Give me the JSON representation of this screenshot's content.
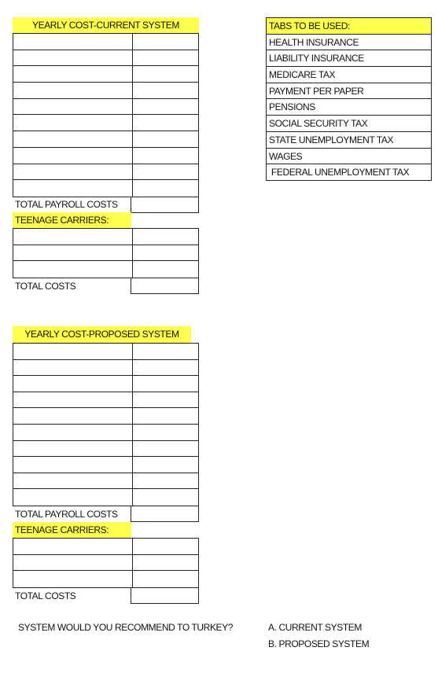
{
  "current": {
    "title": "YEARLY COST-CURRENT SYSTEM",
    "rows": 10,
    "total_payroll_label": "TOTAL PAYROLL COSTS",
    "teenage_label": "TEENAGE CARRIERS:",
    "teen_rows": 3,
    "total_costs_label": "TOTAL COSTS"
  },
  "proposed": {
    "title": "YEARLY COST-PROPOSED SYSTEM",
    "rows": 10,
    "total_payroll_label": "TOTAL PAYROLL COSTS",
    "teenage_label": "TEENAGE CARRIERS:",
    "teen_rows": 3,
    "total_costs_label": "TOTAL COSTS"
  },
  "tabs": {
    "title": "TABS TO BE USED:",
    "items": [
      "HEALTH INSURANCE",
      "LIABILITY INSURANCE",
      "MEDICARE TAX",
      "PAYMENT PER PAPER",
      "PENSIONS",
      "SOCIAL SECURITY TAX",
      "STATE UNEMPLOYMENT TAX",
      "WAGES",
      " FEDERAL UNEMPLOYMENT TAX"
    ]
  },
  "question": {
    "text": "SYSTEM WOULD YOU RECOMMEND TO TURKEY?",
    "option_a": "A. CURRENT SYSTEM",
    "option_b": "B. PROPOSED SYSTEM"
  },
  "colors": {
    "highlight": "#ffff4d",
    "border": "#222222"
  }
}
